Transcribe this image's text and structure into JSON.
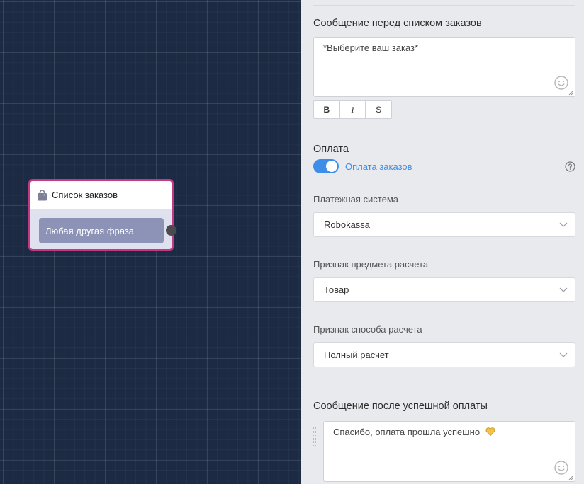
{
  "canvas": {
    "node": {
      "title": "Список заказов",
      "icon": "shopping-bag-icon",
      "option_label": "Любая другая фраза",
      "border_color": "#c23a86"
    }
  },
  "panel": {
    "before_list": {
      "label": "Сообщение перед списком заказов",
      "value": "*Выберите ваш заказ*",
      "format_buttons": [
        "B",
        "I",
        "S"
      ]
    },
    "payment": {
      "label": "Оплата",
      "toggle_on": true,
      "toggle_label": "Оплата заказов",
      "accent_color": "#3d8ee8"
    },
    "payment_system": {
      "label": "Платежная система",
      "value": "Robokassa"
    },
    "item_sign": {
      "label": "Признак предмета расчета",
      "value": "Товар"
    },
    "method_sign": {
      "label": "Признак способа расчета",
      "value": "Полный расчет"
    },
    "after_success": {
      "label": "Сообщение после успешной оплаты",
      "value": "Спасибо, оплата прошла успешно",
      "emoji": "yellow-heart-icon"
    }
  }
}
